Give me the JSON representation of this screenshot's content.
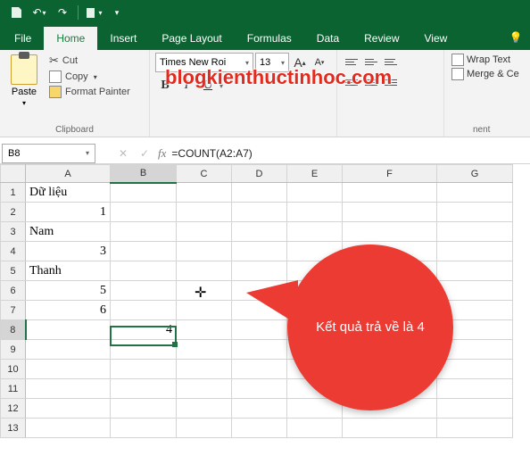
{
  "qat": {
    "save": "save-icon",
    "undo": "undo-icon",
    "redo": "redo-icon",
    "new": "new-icon"
  },
  "tabs": [
    "File",
    "Home",
    "Insert",
    "Page Layout",
    "Formulas",
    "Data",
    "Review",
    "View"
  ],
  "activeTab": "Home",
  "ribbon": {
    "clipboard": {
      "paste": "Paste",
      "cut": "Cut",
      "copy": "Copy",
      "fp": "Format Painter",
      "label": "Clipboard"
    },
    "font": {
      "name": "Times New Roi",
      "size": "13",
      "increase": "A",
      "decrease": "A",
      "bold": "B",
      "italic": "I",
      "underline": "U"
    },
    "align": {
      "wrap": "Wrap Text",
      "merge": "Merge & Ce",
      "labelFrag": "nent"
    }
  },
  "watermark": "blogkienthuctinhoc.com",
  "nameBox": "B8",
  "formula": "=COUNT(A2:A7)",
  "columns": [
    "A",
    "B",
    "C",
    "D",
    "E",
    "F",
    "G"
  ],
  "rows": [
    "1",
    "2",
    "3",
    "4",
    "5",
    "6",
    "7",
    "8",
    "9",
    "10",
    "11",
    "12",
    "13"
  ],
  "cells": {
    "A1": "Dữ liệu",
    "A2": "1",
    "A3": "Nam",
    "A4": "3",
    "A5": "Thanh",
    "A6": "5",
    "A7": "6",
    "B8": "4"
  },
  "callout": "Kết quả trả về là 4"
}
